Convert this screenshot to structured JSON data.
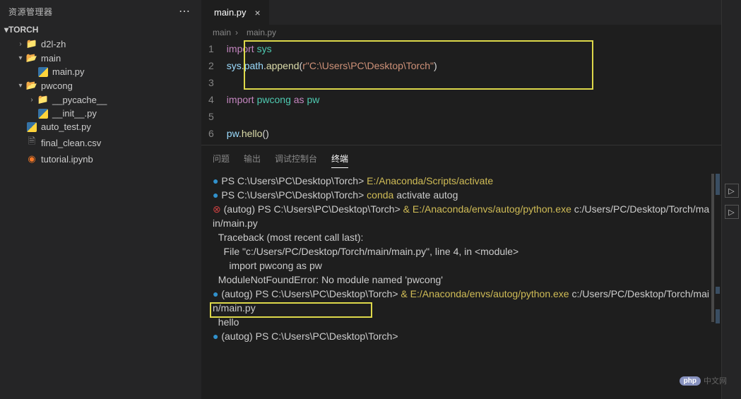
{
  "sidebar": {
    "title": "资源管理器",
    "root": "TORCH",
    "items": [
      {
        "type": "folder",
        "name": "d2l-zh",
        "open": false,
        "indent": 1
      },
      {
        "type": "folder",
        "name": "main",
        "open": true,
        "indent": 1
      },
      {
        "type": "py",
        "name": "main.py",
        "indent": 2
      },
      {
        "type": "folder",
        "name": "pwcong",
        "open": true,
        "indent": 1
      },
      {
        "type": "folder",
        "name": "__pycache__",
        "open": false,
        "indent": 2
      },
      {
        "type": "py",
        "name": "__init__.py",
        "indent": 2
      },
      {
        "type": "py",
        "name": "auto_test.py",
        "indent": 1
      },
      {
        "type": "file",
        "name": "final_clean.csv",
        "indent": 1
      },
      {
        "type": "jupyter",
        "name": "tutorial.ipynb",
        "indent": 1
      }
    ]
  },
  "tab": {
    "file": "main.py",
    "close": "×"
  },
  "breadcrumb": {
    "root": "main",
    "file": "main.py",
    "sep": "›"
  },
  "code": {
    "lines": [
      [
        {
          "t": "import ",
          "c": "kw"
        },
        {
          "t": "sys",
          "c": "mod"
        }
      ],
      [
        {
          "t": "sys",
          "c": "var"
        },
        {
          "t": ".",
          "c": "plain"
        },
        {
          "t": "path",
          "c": "var"
        },
        {
          "t": ".",
          "c": "plain"
        },
        {
          "t": "append",
          "c": "fn"
        },
        {
          "t": "(",
          "c": "plain"
        },
        {
          "t": "r\"C:\\Users\\PC\\Desktop\\Torch\"",
          "c": "str"
        },
        {
          "t": ")",
          "c": "plain"
        }
      ],
      [],
      [
        {
          "t": "import ",
          "c": "kw"
        },
        {
          "t": "pwcong",
          "c": "mod"
        },
        {
          "t": " as ",
          "c": "kw"
        },
        {
          "t": "pw",
          "c": "mod"
        }
      ],
      [],
      [
        {
          "t": "pw",
          "c": "var"
        },
        {
          "t": ".",
          "c": "plain"
        },
        {
          "t": "hello",
          "c": "fn"
        },
        {
          "t": "()",
          "c": "plain"
        }
      ]
    ]
  },
  "panels": {
    "tabs": [
      "问题",
      "输出",
      "调试控制台",
      "终端"
    ],
    "active": 3
  },
  "terminal": {
    "lines": [
      {
        "marker": "blue",
        "segs": [
          {
            "t": "PS C:\\Users\\PC\\Desktop\\Torch> "
          },
          {
            "t": "E:/Anaconda/Scripts/activate",
            "c": "y"
          }
        ]
      },
      {
        "marker": "blue",
        "segs": [
          {
            "t": "PS C:\\Users\\PC\\Desktop\\Torch> "
          },
          {
            "t": "conda ",
            "c": "y"
          },
          {
            "t": "activate autog"
          }
        ]
      },
      {
        "marker": "red",
        "segs": [
          {
            "t": "(autog) PS C:\\Users\\PC\\Desktop\\Torch> "
          },
          {
            "t": "& ",
            "c": "y"
          },
          {
            "t": "E:/Anaconda/envs/autog/python.exe ",
            "c": "y"
          },
          {
            "t": "c:/Users/PC/Desktop/Torch/main/main.py"
          }
        ]
      },
      {
        "marker": "",
        "segs": [
          {
            "t": "Traceback (most recent call last):"
          }
        ]
      },
      {
        "marker": "",
        "segs": [
          {
            "t": "  File \"c:/Users/PC/Desktop/Torch/main/main.py\", line 4, in <module>"
          }
        ]
      },
      {
        "marker": "",
        "segs": [
          {
            "t": "    import pwcong as pw"
          }
        ]
      },
      {
        "marker": "",
        "segs": [
          {
            "t": "ModuleNotFoundError: No module named 'pwcong'"
          }
        ]
      },
      {
        "marker": "blue",
        "segs": [
          {
            "t": "(autog) PS C:\\Users\\PC\\Desktop\\Torch> "
          },
          {
            "t": "& ",
            "c": "y"
          },
          {
            "t": "E:/Anaconda/envs/autog/python.exe ",
            "c": "y"
          },
          {
            "t": "c:/Users/PC/Desktop/Torch/main/main.py"
          }
        ]
      },
      {
        "marker": "",
        "segs": [
          {
            "t": "hello"
          }
        ]
      },
      {
        "marker": "blue",
        "segs": [
          {
            "t": "(autog) PS C:\\Users\\PC\\Desktop\\Torch> "
          }
        ]
      }
    ]
  },
  "watermark": {
    "badge": "php",
    "text": "中文网"
  }
}
